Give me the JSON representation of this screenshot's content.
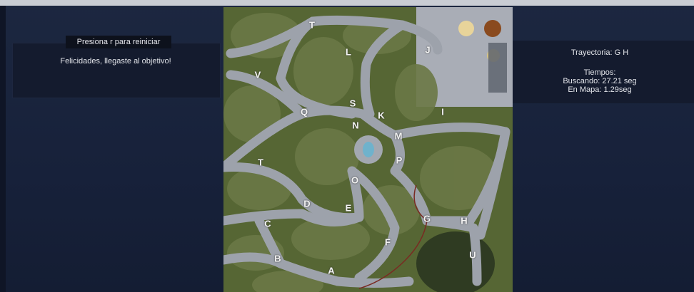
{
  "left_panel": {
    "restart_hint": "Presiona r para reiniciar",
    "message": "Felicidades, llegaste al objetivo!"
  },
  "right_panel": {
    "trajectory": "Trayectoria: G H",
    "times_title": "Tiempos:",
    "search_time": "Buscando: 27.21 seg",
    "map_time": "En Mapa: 1.29seg"
  },
  "map": {
    "nodes": [
      "T",
      "L",
      "J",
      "V",
      "S",
      "Q",
      "K",
      "I",
      "N",
      "M",
      "P",
      "T",
      "O",
      "D",
      "E",
      "G",
      "H",
      "C",
      "F",
      "U",
      "B",
      "A"
    ]
  },
  "colors": {
    "background": "#17213a",
    "grass": "#5a6a35",
    "road": "#9a9fa8"
  }
}
